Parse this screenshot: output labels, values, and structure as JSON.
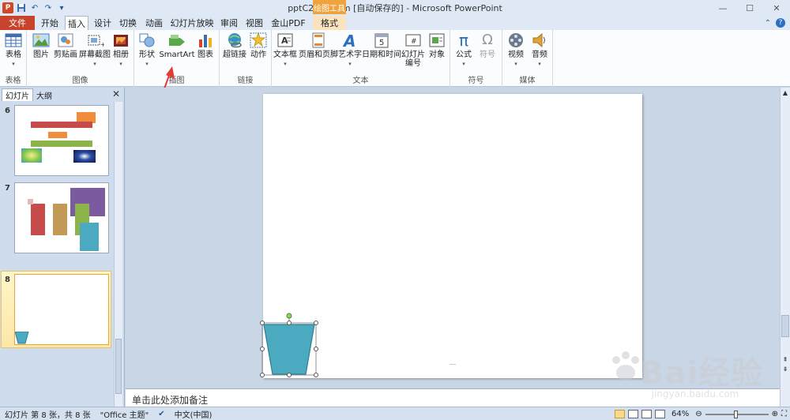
{
  "titlebar": {
    "title": "pptC284.pptm [自动保存的] - Microsoft PowerPoint",
    "undo_icon": "undo-icon",
    "redo_icon": "redo-icon"
  },
  "tabs": {
    "file": "文件",
    "items": [
      "开始",
      "插入",
      "设计",
      "切换",
      "动画",
      "幻灯片放映",
      "审阅",
      "视图",
      "金山PDF"
    ],
    "active": "插入",
    "context_header": "绘图工具",
    "context_tab": "格式"
  },
  "ribbon": {
    "groups": {
      "table": {
        "label": "表格",
        "buttons": [
          "表格"
        ]
      },
      "images": {
        "label": "图像",
        "buttons": [
          "图片",
          "剪贴画",
          "屏幕截图",
          "相册"
        ]
      },
      "illustrations": {
        "label": "插图",
        "buttons": [
          "形状",
          "SmartArt",
          "图表"
        ]
      },
      "links": {
        "label": "链接",
        "buttons": [
          "超链接",
          "动作"
        ]
      },
      "text": {
        "label": "文本",
        "buttons": [
          "文本框",
          "页眉和页脚",
          "艺术字",
          "日期和时间",
          "幻灯片",
          "编号",
          "对象"
        ]
      },
      "symbols": {
        "label": "符号",
        "buttons": [
          "公式",
          "符号"
        ]
      },
      "media": {
        "label": "媒体",
        "buttons": [
          "视频",
          "音频"
        ]
      }
    }
  },
  "leftpanel": {
    "tab_slides": "幻灯片",
    "tab_outline": "大纲",
    "close": "✕",
    "slides": [
      {
        "number": "6"
      },
      {
        "number": "7"
      },
      {
        "number": "8",
        "selected": true
      }
    ]
  },
  "notes": {
    "placeholder": "单击此处添加备注"
  },
  "status": {
    "slide_info": "幻灯片 第 8 张，共 8 张",
    "theme": "\"Office 主题\"",
    "language": "中文(中国)",
    "zoom": "64%"
  },
  "watermark": {
    "brand": "Bai经验",
    "url": "jingyan.baidu.com"
  },
  "colors": {
    "accent_file": "#c8432b",
    "shape_teal": "#4ba9c0",
    "annotation_red": "#e53935"
  }
}
